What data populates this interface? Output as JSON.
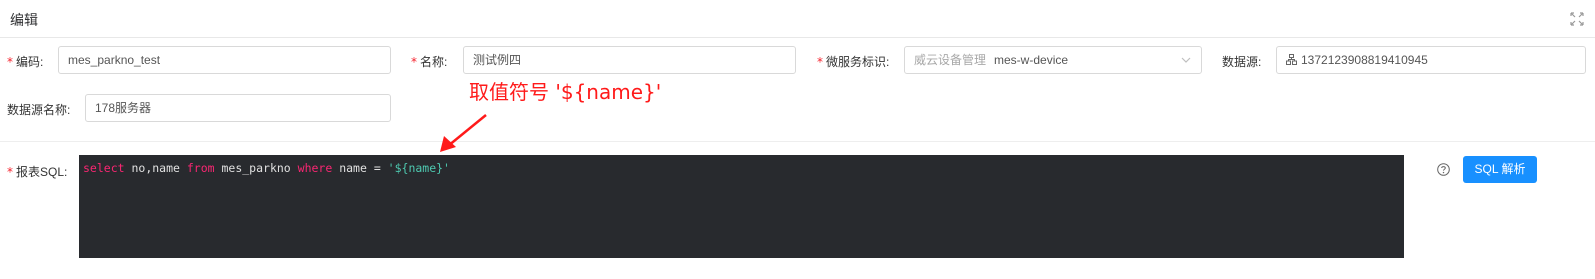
{
  "modal": {
    "title": "编辑"
  },
  "form": {
    "code": {
      "label": "编码:",
      "value": "mes_parkno_test",
      "required": true
    },
    "name": {
      "label": "名称:",
      "value": "测试例四",
      "required": true
    },
    "service": {
      "label": "微服务标识:",
      "tag": "威云设备管理",
      "value": "mes-w-device",
      "required": true
    },
    "datasource": {
      "label": "数据源:",
      "value": "1372123908819410945"
    },
    "datasource_name": {
      "label": "数据源名称:",
      "value": "178服务器"
    },
    "sql": {
      "label": "报表SQL:",
      "required": true,
      "tokens": [
        {
          "text": "select",
          "type": "keyword"
        },
        {
          "text": " no,name ",
          "type": "plain"
        },
        {
          "text": "from",
          "type": "keyword"
        },
        {
          "text": " mes_parkno ",
          "type": "plain"
        },
        {
          "text": "where",
          "type": "keyword"
        },
        {
          "text": " name = ",
          "type": "plain"
        },
        {
          "text": "'${name}'",
          "type": "string"
        }
      ]
    }
  },
  "actions": {
    "parse_label": "SQL 解析"
  },
  "annotation": {
    "text": "取值符号 '${name}'"
  },
  "colors": {
    "primary": "#1890ff",
    "required": "#f5222d",
    "annotation": "#ff1a1a",
    "editor_bg": "#282a2e",
    "keyword": "#f92672",
    "string": "#4ec9b0"
  },
  "icons": [
    "fullscreen-icon",
    "chevron-down-icon",
    "datasource-icon",
    "help-icon",
    "annotation-arrow"
  ]
}
